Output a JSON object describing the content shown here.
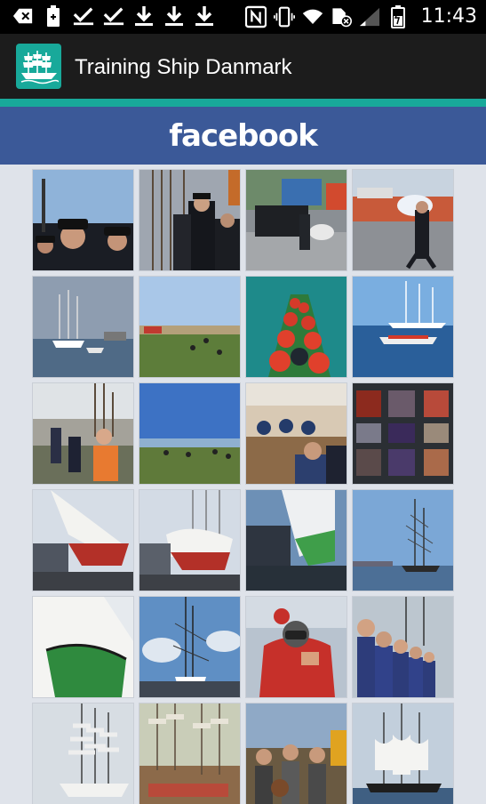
{
  "status_bar": {
    "time": "11:43",
    "left_icons": [
      "back-icon",
      "battery-saver-icon",
      "check-icon",
      "check-icon",
      "download-icon",
      "download-icon",
      "download-icon"
    ],
    "right_icons": [
      "nfc-icon",
      "vibrate-icon",
      "wifi-icon",
      "no-sim-icon",
      "signal-icon",
      "battery-icon"
    ]
  },
  "app_bar": {
    "title": "Training Ship Danmark",
    "logo_icon": "ship-logo-icon",
    "accent_color": "#18a99a",
    "bar_color": "#1c1c1c"
  },
  "facebook_banner": {
    "label": "facebook",
    "color": "#3b5998"
  },
  "photo_grid": {
    "columns": 4,
    "photos": [
      {
        "name": "sailors-with-caps"
      },
      {
        "name": "officers-on-deck"
      },
      {
        "name": "harbor-loading"
      },
      {
        "name": "dock-worker"
      },
      {
        "name": "tall-ship-harbor"
      },
      {
        "name": "field-gathering"
      },
      {
        "name": "rowing-boat-crew"
      },
      {
        "name": "ship-with-boat"
      },
      {
        "name": "hiking-group"
      },
      {
        "name": "coastal-field"
      },
      {
        "name": "classroom"
      },
      {
        "name": "photo-collage"
      },
      {
        "name": "hull-drydock-1"
      },
      {
        "name": "hull-drydock-2"
      },
      {
        "name": "green-hull-drydock"
      },
      {
        "name": "masts-distance"
      },
      {
        "name": "green-hull-closeup"
      },
      {
        "name": "rigging-sky"
      },
      {
        "name": "crew-member-red-jacket"
      },
      {
        "name": "cadets-line"
      },
      {
        "name": "full-rigged-ship"
      },
      {
        "name": "tall-ships-race"
      },
      {
        "name": "crew-on-deck"
      },
      {
        "name": "ship-sailing"
      }
    ]
  }
}
